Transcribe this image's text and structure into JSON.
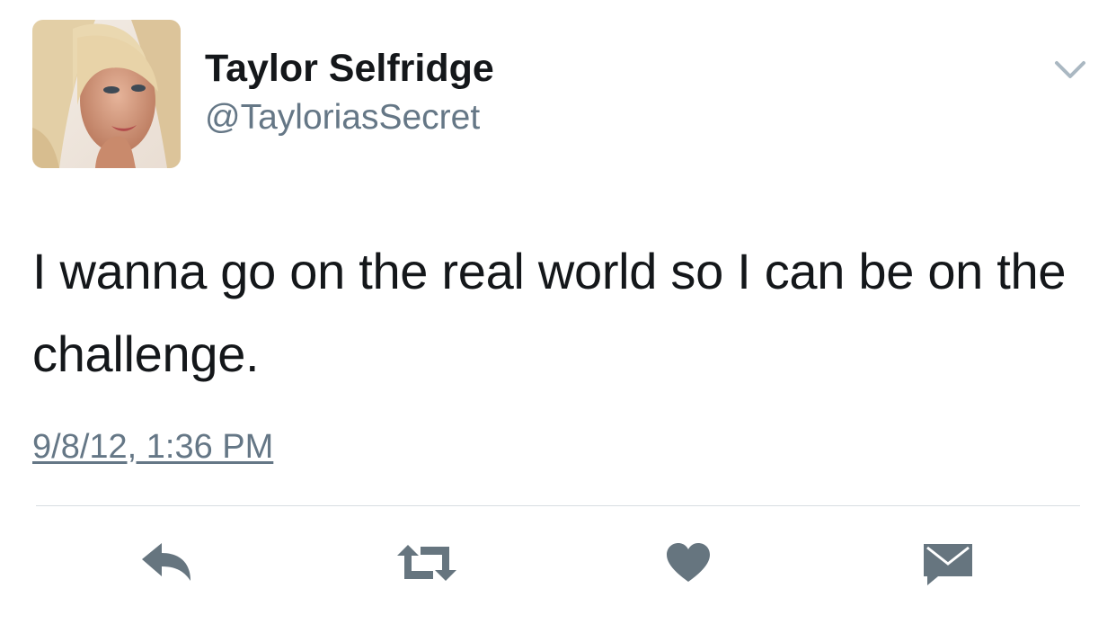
{
  "tweet": {
    "display_name": "Taylor Selfridge",
    "handle": "@TayloriasSecret",
    "text": "I wanna go on the real world so I can be on the challenge.",
    "timestamp": "9/8/12, 1:36 PM"
  },
  "icons": {
    "menu": "chevron-down-icon",
    "reply": "reply-icon",
    "retweet": "retweet-icon",
    "like": "heart-icon",
    "message": "envelope-icon"
  },
  "colors": {
    "text": "#14171a",
    "secondary": "#657786",
    "action_icon": "#66757f",
    "divider": "#d8dde1"
  }
}
